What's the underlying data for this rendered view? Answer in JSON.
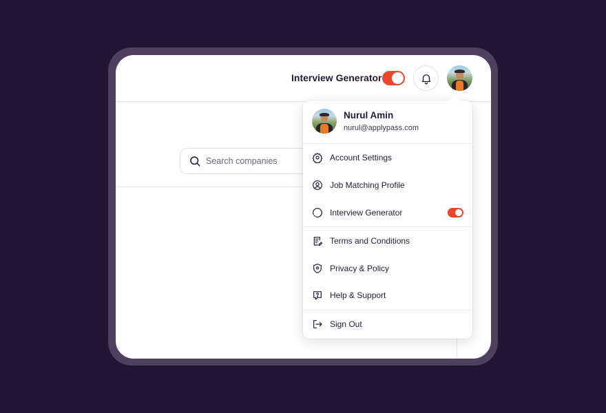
{
  "topbar": {
    "interview_label": "Interview Generator",
    "interview_toggle_on": true
  },
  "search": {
    "placeholder": "Search companies"
  },
  "profile_menu": {
    "user": {
      "name": "Nurul Amin",
      "email": "nurul@applypass.com"
    },
    "items": [
      {
        "label": "Account Settings",
        "icon": "gear-icon"
      },
      {
        "label": "Job Matching Profile",
        "icon": "user-circle-icon"
      },
      {
        "label": "Interview Generator",
        "icon": "loading-circle-icon",
        "toggle_on": true
      },
      {
        "label": "Terms and Conditions",
        "icon": "document-edit-icon"
      },
      {
        "label": "Privacy & Policy",
        "icon": "shield-pin-icon"
      },
      {
        "label": "Help & Support",
        "icon": "help-bubble-icon"
      },
      {
        "label": "Sign Out",
        "icon": "sign-out-icon"
      }
    ]
  },
  "colors": {
    "background": "#221433",
    "accent": "#e8472c",
    "text": "#241a30"
  }
}
